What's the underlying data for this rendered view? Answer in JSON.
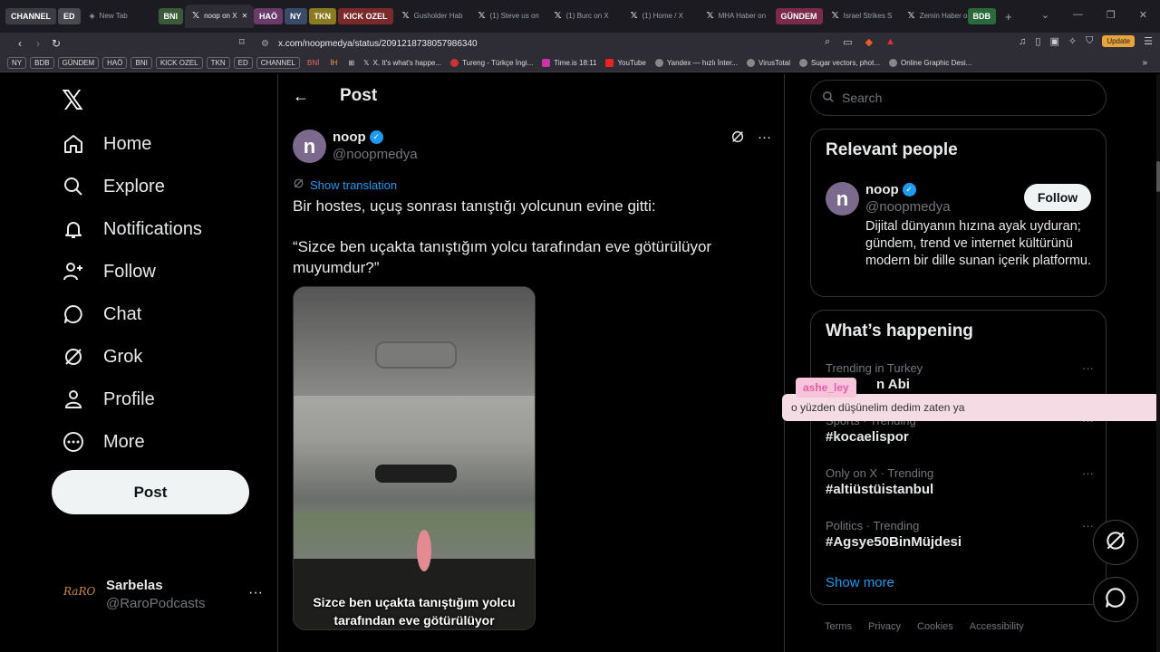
{
  "browser": {
    "tab_groups": [
      {
        "label": "CHANNEL",
        "color": "#3c3c44"
      },
      {
        "label": "ED",
        "color": "#4a4a52"
      },
      {
        "label": "BNI",
        "color": "#3a5a3a"
      },
      {
        "label": "HAÖ",
        "color": "#6a3a6a"
      },
      {
        "label": "NY",
        "color": "#3a4a6a"
      },
      {
        "label": "TKN",
        "color": "#8a7a20"
      },
      {
        "label": "KICK OZEL",
        "color": "#7a2a2a"
      },
      {
        "label": "GÜNDEM",
        "color": "#7a2a4a"
      },
      {
        "label": "BDB",
        "color": "#2a6a3a"
      }
    ],
    "tabs": [
      "New Tab",
      "noop on X",
      "Gusholder Hab",
      "(1) Steve us on",
      "(1) Burc on X",
      "(1) Home / X",
      "MHA Haber on",
      "Israel Strikes S",
      "Zemin Haber o"
    ],
    "url": "x.com/noopmedya/status/2091218738057986340",
    "update_label": "Update",
    "bookmark_tags": [
      "NY",
      "BDB",
      "GÜNDEM",
      "HAÖ",
      "BNI",
      "KICK OZEL",
      "TKN",
      "ED",
      "CHANNEL",
      "BNİ",
      "İH"
    ],
    "bookmarks": [
      "X. It's what's happe...",
      "Tureng - Türkçe İngi...",
      "Time.is 18:11",
      "YouTube",
      "Yandex — hızlı İnter...",
      "VirusTotal",
      "Sugar vectors, phot...",
      "Online Graphic Desi..."
    ]
  },
  "nav": {
    "items": [
      {
        "label": "Home",
        "icon": "home-icon"
      },
      {
        "label": "Explore",
        "icon": "search-icon"
      },
      {
        "label": "Notifications",
        "icon": "bell-icon"
      },
      {
        "label": "Follow",
        "icon": "add-person-icon"
      },
      {
        "label": "Chat",
        "icon": "chat-icon"
      },
      {
        "label": "Grok",
        "icon": "grok-icon"
      },
      {
        "label": "Profile",
        "icon": "person-icon"
      },
      {
        "label": "More",
        "icon": "more-circle-icon"
      }
    ],
    "post_label": "Post",
    "account": {
      "name": "Sarbelas",
      "handle": "@RaroPodcasts",
      "avatar_text": "RaRO"
    }
  },
  "main": {
    "title": "Post",
    "author": {
      "name": "noop",
      "handle": "@noopmedya",
      "avatar_letter": "n"
    },
    "show_translation": "Show translation",
    "text_line1": "Bir hostes, uçuş sonrası tanıştığı yolcunun evine gitti:",
    "text_line2": "“Sizce ben uçakta tanıştığım yolcu tarafından eve götürülüyor muyumdur?”",
    "media_caption_1": "Sizce ben uçakta tanıştığım yolcu",
    "media_caption_2": "tarafından eve götürülüyor"
  },
  "sidebar": {
    "search_placeholder": "Search",
    "relevant_title": "Relevant people",
    "relevant_person": {
      "name": "noop",
      "handle": "@noopmedya",
      "follow_label": "Follow",
      "bio": "Dijital dünyanın hızına ayak uyduran; gündem, trend ve internet kültürünü modern bir dille sunan içerik platformu."
    },
    "happening_title": "What’s happening",
    "trends": [
      {
        "meta": "Trending in Turkey",
        "name": "n Abi"
      },
      {
        "meta": "Sports · Trending",
        "name": "#kocaelispor"
      },
      {
        "meta": "Only on X · Trending",
        "name": "#altiüstüistanbul"
      },
      {
        "meta": "Politics · Trending",
        "name": "#Agsye50BinMüjdesi"
      }
    ],
    "show_more": "Show more",
    "footer": [
      "Terms",
      "Privacy",
      "Cookies",
      "Accessibility"
    ]
  },
  "overlay": {
    "user": "ashe_ley",
    "message": "o yüzden düşünelim dedim zaten ya"
  },
  "colors": {
    "accent": "#1d9bf0",
    "background": "#000000",
    "border": "#2f3336"
  }
}
